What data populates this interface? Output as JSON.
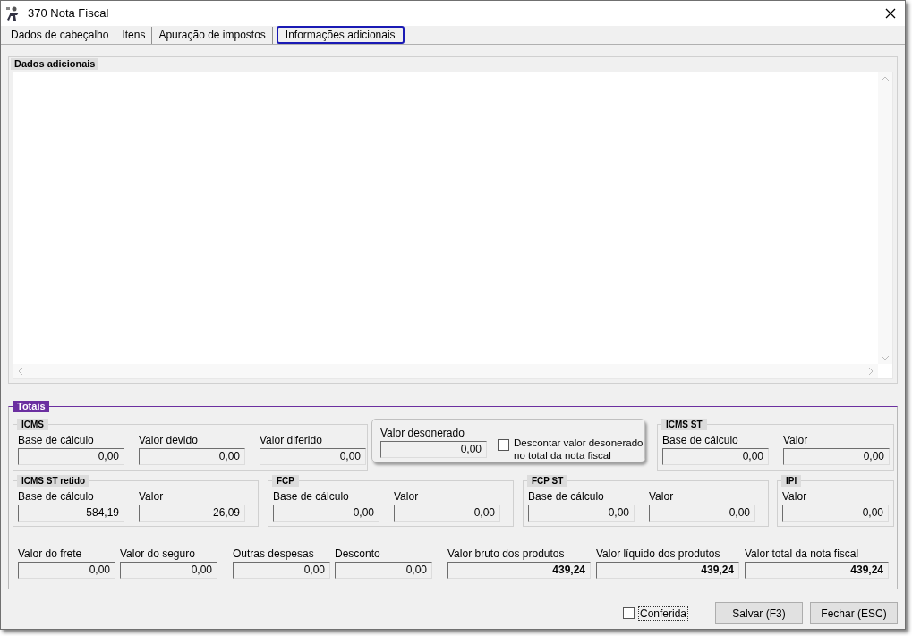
{
  "window": {
    "title": "370 Nota Fiscal"
  },
  "tabs": [
    {
      "label": "Dados de cabeçalho",
      "selected": false
    },
    {
      "label": "Itens",
      "selected": false
    },
    {
      "label": "Apuração de impostos",
      "selected": false
    },
    {
      "label": "Informações adicionais",
      "selected": true
    }
  ],
  "dados_adicionais": {
    "title": "Dados adicionais"
  },
  "totais": {
    "title": "Totais",
    "row_1": [
      {
        "kind": "group",
        "title": "ICMS",
        "fields": [
          {
            "label": "Base de cálculo",
            "value": "0,00"
          },
          {
            "label": "Valor devido",
            "value": "0,00"
          },
          {
            "label": "Valor diferido",
            "value": "0,00"
          }
        ]
      },
      {
        "kind": "panel",
        "fields": [
          {
            "label": "Valor desonerado",
            "value": "0,00"
          }
        ],
        "checkbox": {
          "label": "Descontar valor desonerado no total da nota fiscal",
          "checked": false
        }
      },
      {
        "kind": "group",
        "title": "ICMS ST",
        "fields": [
          {
            "label": "Base de cálculo",
            "value": "0,00"
          },
          {
            "label": "Valor",
            "value": "0,00"
          }
        ]
      }
    ],
    "row_2": [
      {
        "kind": "group",
        "title": "ICMS ST retido",
        "fields": [
          {
            "label": "Base de cálculo",
            "value": "584,19"
          },
          {
            "label": "Valor",
            "value": "26,09"
          }
        ]
      },
      {
        "kind": "group",
        "title": "FCP",
        "fields": [
          {
            "label": "Base de cálculo",
            "value": "0,00"
          },
          {
            "label": "Valor",
            "value": "0,00"
          }
        ]
      },
      {
        "kind": "group",
        "title": "FCP ST",
        "fields": [
          {
            "label": "Base de cálculo",
            "value": "0,00"
          },
          {
            "label": "Valor",
            "value": "0,00"
          }
        ]
      },
      {
        "kind": "group",
        "title": "IPI",
        "fields": [
          {
            "label": "Valor",
            "value": "0,00"
          }
        ]
      }
    ],
    "summary": [
      {
        "label": "Valor do frete",
        "value": "0,00",
        "bold": false
      },
      {
        "label": "Valor do seguro",
        "value": "0,00",
        "bold": false
      },
      {
        "label": "Outras despesas",
        "value": "0,00",
        "bold": false
      },
      {
        "label": "Desconto",
        "value": "0,00",
        "bold": false
      },
      {
        "label": "Valor bruto dos produtos",
        "value": "439,24",
        "bold": true
      },
      {
        "label": "Valor líquido dos produtos",
        "value": "439,24",
        "bold": true
      },
      {
        "label": "Valor total da nota fiscal",
        "value": "439,24",
        "bold": true
      }
    ]
  },
  "footer": {
    "checkbox": {
      "label": "Conferida",
      "checked": false
    },
    "buttons": [
      "Salvar (F3)",
      "Fechar (ESC)"
    ]
  }
}
